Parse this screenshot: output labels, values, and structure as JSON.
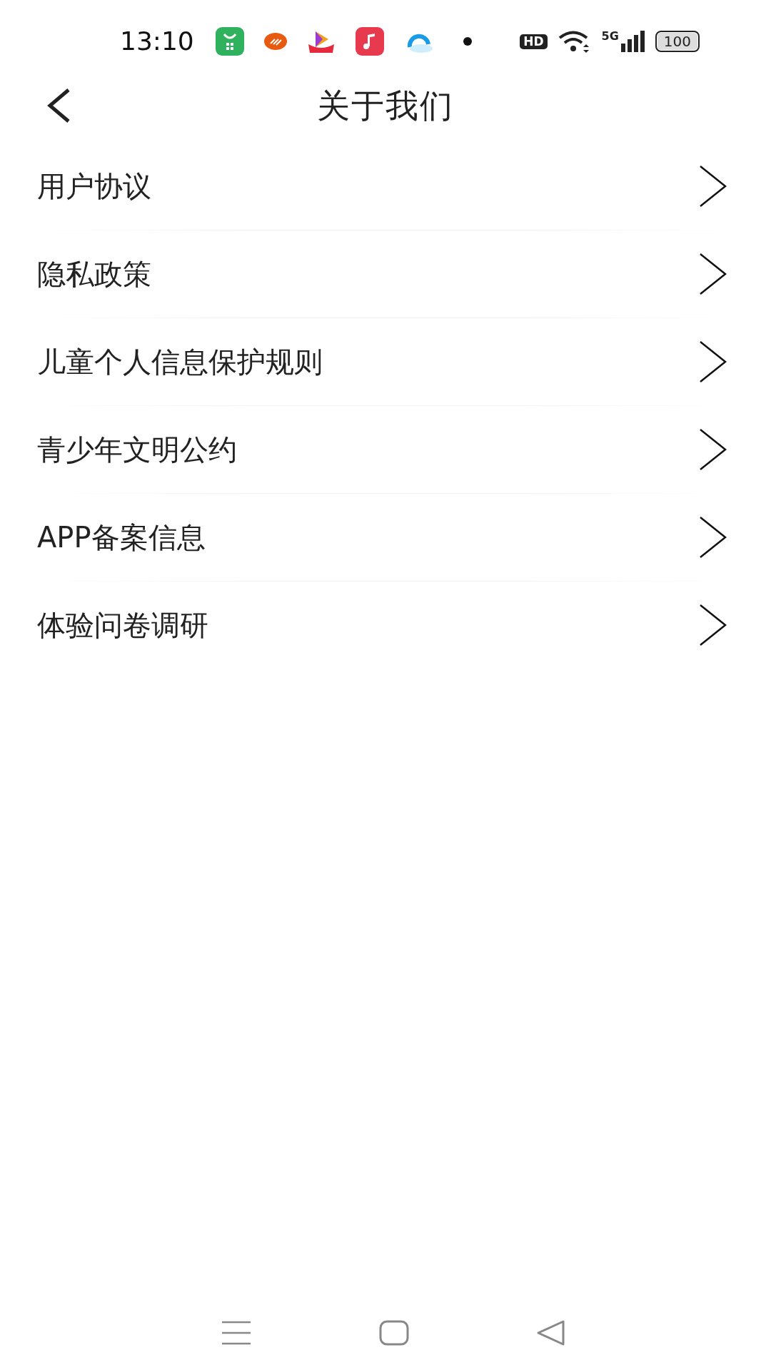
{
  "status_bar": {
    "time": "13:10",
    "hd": "HD",
    "network": "5G",
    "battery": "100"
  },
  "header": {
    "title": "关于我们"
  },
  "items": [
    {
      "label": "用户协议"
    },
    {
      "label": "隐私政策"
    },
    {
      "label": "儿童个人信息保护规则"
    },
    {
      "label": "青少年文明公约"
    },
    {
      "label": "APP备案信息"
    },
    {
      "label": "体验问卷调研"
    }
  ]
}
